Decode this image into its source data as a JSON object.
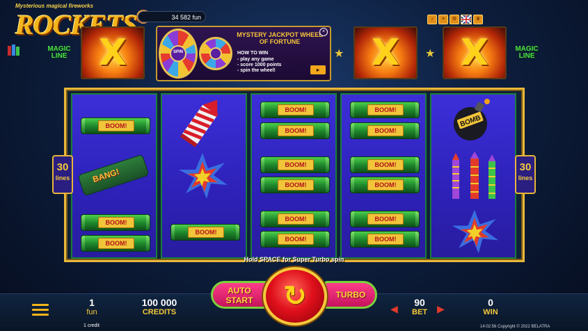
{
  "logo": {
    "tagline": "Mysterious magical fireworks",
    "title": "ROCKETS"
  },
  "balance": {
    "text": "34 582 fun"
  },
  "magic_line": {
    "left": "MAGIC LINE",
    "right": "MAGIC LINE"
  },
  "x_tiles": [
    "X",
    "X",
    "X"
  ],
  "jackpot": {
    "title": "MYSTERY JACKPOT WHEEL OF FORTUNE",
    "how_to_win": "HOW TO WIN",
    "steps": [
      "- play any game",
      "- score 1000 points",
      "- spin the wheel!"
    ],
    "spin_label": "SPIN",
    "close": "×",
    "arrow": "▸"
  },
  "top_buttons": [
    "sound-icon",
    "paytable-icon",
    "settings-icon",
    "language-flag-icon",
    "trophy-icon"
  ],
  "lines": {
    "left_count": "30",
    "left_label": "lines",
    "right_count": "30",
    "right_label": "lines"
  },
  "reels": {
    "boom_label": "BOOM!",
    "bang_label": "BANG!",
    "bomb_label": "BOMB"
  },
  "hint": "Hold SPACE for Super Turbo spin",
  "controls": {
    "auto_start": "AUTO START",
    "turbo": "TURBO",
    "spin_glyph": "↻"
  },
  "stats": {
    "coin_value": "1",
    "coin_label": "fun",
    "credits_value": "100 000",
    "credits_label": "CREDITS",
    "bet_value": "90",
    "bet_label": "BET",
    "win_value": "0",
    "win_label": "WIN"
  },
  "footer": {
    "credit": "1 credit",
    "copyright": "14:02:56   Copyright © 2022 BELATRA"
  },
  "colors": {
    "accent_gold": "#f5c93a",
    "reel_blue": "#3c2fd8",
    "boom_green": "#1f8a2d",
    "spin_red": "#e0101c"
  }
}
